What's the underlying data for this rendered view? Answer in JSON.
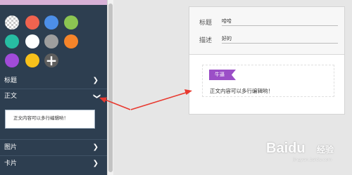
{
  "sidebar": {
    "swatches": [
      {
        "name": "transparent-swatch",
        "color": "transparent"
      },
      {
        "name": "red-swatch",
        "color": "#f0634f"
      },
      {
        "name": "blue-swatch",
        "color": "#4d8fe8"
      },
      {
        "name": "green-swatch",
        "color": "#8cc552"
      },
      {
        "name": "teal-swatch",
        "color": "#27bda2"
      },
      {
        "name": "white-swatch",
        "color": "#ffffff"
      },
      {
        "name": "gray-swatch",
        "color": "#9e9e9e"
      },
      {
        "name": "orange-swatch",
        "color": "#f5842a"
      },
      {
        "name": "purple-swatch",
        "color": "#a14bd8"
      },
      {
        "name": "yellow-swatch",
        "color": "#f8c11b"
      }
    ],
    "add_label": "+",
    "sections": {
      "title": {
        "label": "标题",
        "icon": "chevron-right-icon"
      },
      "body": {
        "label": "正文",
        "icon": "chevron-down-icon"
      },
      "image": {
        "label": "图片",
        "icon": "chevron-right-icon"
      },
      "card": {
        "label": "卡片",
        "icon": "chevron-right-icon"
      }
    },
    "body_text": "正文内容可以多行编辑哟！"
  },
  "card": {
    "title_label": "标题",
    "title_value": "哈哈",
    "desc_label": "描述",
    "desc_value": "好的",
    "tag_text": "牛逼",
    "preview_text": "正文内容可以多行编辑哟！"
  },
  "watermark": {
    "brand": "Baidu",
    "sub": "经验",
    "url": "jingyan.baidu.com"
  },
  "annotation_color": "#e8392f"
}
